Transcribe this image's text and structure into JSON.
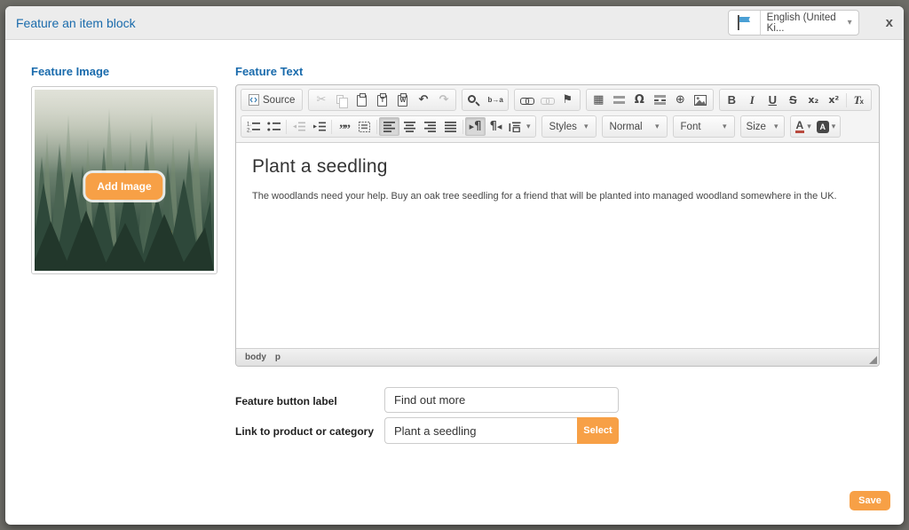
{
  "header": {
    "title": "Feature an item block",
    "language": {
      "value": "English (United Ki..."
    },
    "close": "x"
  },
  "feature_image": {
    "label": "Feature Image",
    "add_button": "Add Image"
  },
  "feature_text": {
    "label": "Feature Text"
  },
  "editor": {
    "toolbar": {
      "source_label": "Source",
      "dropdowns": {
        "styles": "Styles",
        "format": "Normal",
        "font": "Font",
        "size": "Size"
      },
      "row1_buttons": [
        "source",
        "cut",
        "copy",
        "paste",
        "paste-plain-text",
        "paste-from-word",
        "undo",
        "redo",
        "find",
        "replace",
        "link",
        "unlink",
        "anchor",
        "table",
        "horizontal-rule",
        "special-character",
        "page-break",
        "iframe",
        "image",
        "bold",
        "italic",
        "underline",
        "strikethrough",
        "subscript",
        "superscript",
        "remove-format"
      ],
      "row2_buttons": [
        "numbered-list",
        "bulleted-list",
        "decrease-indent",
        "increase-indent",
        "blockquote",
        "div-container",
        "align-left",
        "align-center",
        "align-right",
        "justify",
        "text-direction-ltr",
        "text-direction-rtl",
        "language",
        "styles",
        "format",
        "font",
        "size",
        "text-color",
        "background-color"
      ],
      "disabled_buttons": [
        "cut",
        "copy",
        "redo",
        "unlink",
        "decrease-indent"
      ],
      "active_buttons": [
        "align-left",
        "text-direction-ltr"
      ]
    },
    "content": {
      "heading": "Plant a seedling",
      "paragraph": "The woodlands need your help. Buy an oak tree seedling for a friend that will be planted into managed woodland somewhere in the UK."
    },
    "status_bar": {
      "body": "body",
      "p": "p"
    }
  },
  "fields": {
    "button_label": {
      "label": "Feature button label",
      "value": "Find out more"
    },
    "link": {
      "label": "Link to product or category",
      "value": "Plant a seedling",
      "select_button": "Select"
    }
  },
  "save_button": "Save",
  "icons": {
    "caret": "▾",
    "cut": "✂",
    "undo": "↶",
    "redo": "↷",
    "paste_plain_letter": "T",
    "paste_word_letter": "W",
    "replace": "b→a",
    "anchor": "⚑",
    "table": "▦",
    "special_character": "Ω",
    "iframe": "⊕",
    "bold": "B",
    "italic": "I",
    "underline": "U",
    "strikethrough": "S",
    "subscript": "x₂",
    "superscript": "x²",
    "remove_format_t": "T",
    "remove_format_x": "x",
    "blockquote": "””",
    "tri_right": "▸",
    "tri_left": "◂",
    "pilcrow": "¶",
    "text_color_letter": "A",
    "bg_color_letter": "A"
  },
  "colors": {
    "accent_orange": "#f7a046",
    "title_blue": "#1a6bac"
  }
}
